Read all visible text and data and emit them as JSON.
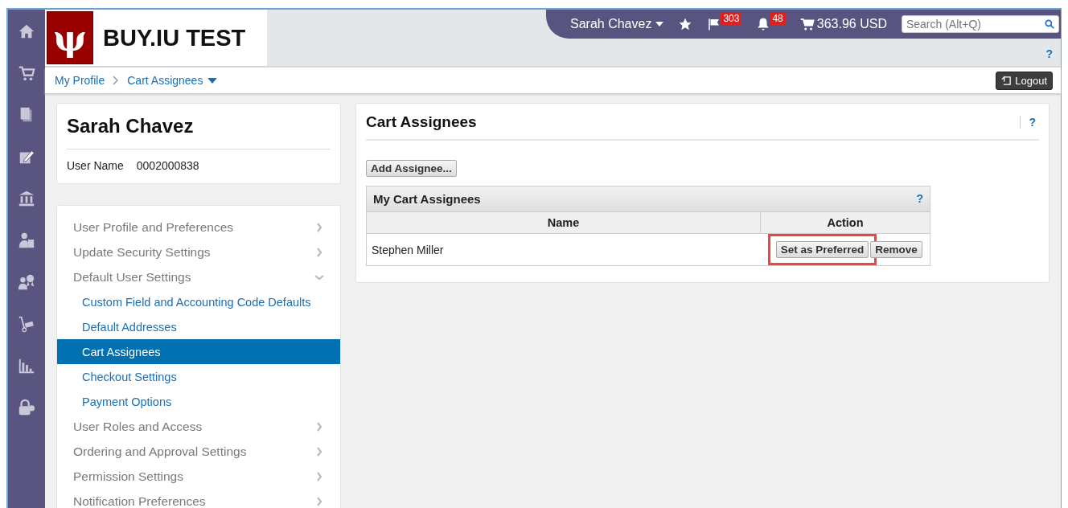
{
  "header": {
    "logo_mark": "ψ",
    "logo_text": "BUY.IU TEST",
    "user_menu": "Sarah Chavez",
    "flag_count": "303",
    "bell_count": "48",
    "cart_total": "363.96 USD",
    "search": {
      "placeholder": "Search (Alt+Q)"
    },
    "help": "?"
  },
  "breadcrumb": {
    "items": [
      {
        "label": "My Profile",
        "kind": "link"
      },
      {
        "label": "Cart Assignees",
        "kind": "menu"
      }
    ],
    "logout": "Logout"
  },
  "profile": {
    "name": "Sarah Chavez",
    "username_label": "User Name",
    "username": "0002000838"
  },
  "menu": [
    {
      "label": "User Profile and Preferences",
      "kind": "section",
      "expanded": false,
      "selected": false
    },
    {
      "label": "Update Security Settings",
      "kind": "section",
      "expanded": false,
      "selected": false
    },
    {
      "label": "Default User Settings",
      "kind": "section",
      "expanded": true,
      "selected": false
    },
    {
      "label": "Custom Field and Accounting Code Defaults",
      "kind": "sub",
      "selected": false
    },
    {
      "label": "Default Addresses",
      "kind": "sub",
      "selected": false
    },
    {
      "label": "Cart Assignees",
      "kind": "sub",
      "selected": true
    },
    {
      "label": "Checkout Settings",
      "kind": "sub",
      "selected": false
    },
    {
      "label": "Payment Options",
      "kind": "sub",
      "selected": false
    },
    {
      "label": "User Roles and Access",
      "kind": "section",
      "expanded": false,
      "selected": false
    },
    {
      "label": "Ordering and Approval Settings",
      "kind": "section",
      "expanded": false,
      "selected": false
    },
    {
      "label": "Permission Settings",
      "kind": "section",
      "expanded": false,
      "selected": false
    },
    {
      "label": "Notification Preferences",
      "kind": "section",
      "expanded": false,
      "selected": false
    }
  ],
  "main": {
    "title": "Cart Assignees",
    "help": "?",
    "add_button": "Add Assignee...",
    "table": {
      "title": "My Cart Assignees",
      "help": "?",
      "columns": [
        "Name",
        "Action"
      ],
      "rows": [
        {
          "name": "Stephen Miller",
          "actions": [
            {
              "label": "Set as Preferred",
              "highlighted": true
            },
            {
              "label": "Remove",
              "highlighted": false
            }
          ]
        }
      ]
    }
  }
}
